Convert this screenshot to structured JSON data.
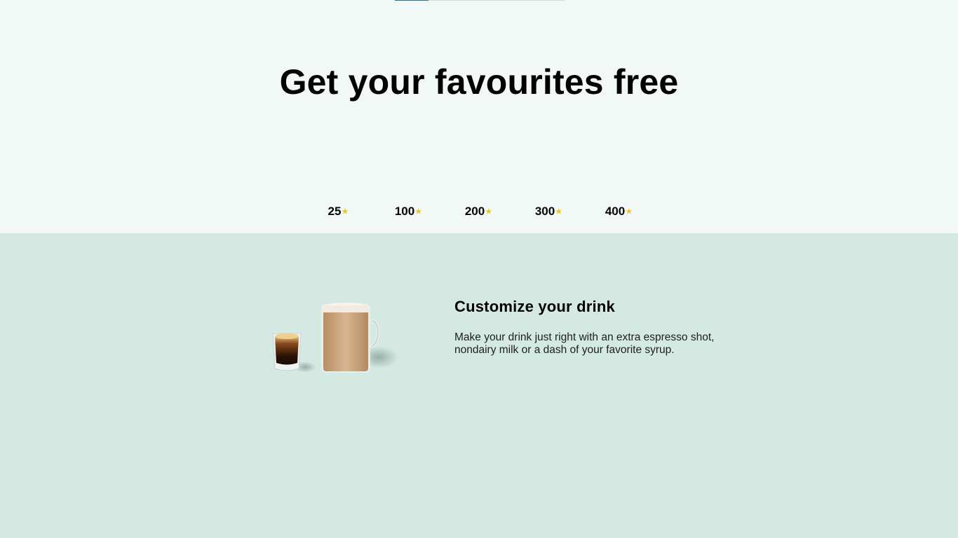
{
  "rewards": {
    "headline": "Get your favourites free",
    "tiers": [
      {
        "value": "25",
        "icon": "star-icon"
      },
      {
        "value": "100",
        "icon": "star-icon"
      },
      {
        "value": "200",
        "icon": "star-icon"
      },
      {
        "value": "300",
        "icon": "star-icon"
      },
      {
        "value": "400",
        "icon": "star-icon"
      }
    ],
    "star_glyph": "★"
  },
  "feature": {
    "title": "Customize your drink",
    "description": "Make your drink just right with an extra espresso shot, nondairy milk or a dash of your favorite syrup.",
    "image": "espresso-and-latte-mug"
  },
  "colors": {
    "top_background": "#f1f8f6",
    "bottom_background": "#d4e9e2",
    "star": "#f0c419",
    "scroll_thumb": "#1f6fb5"
  }
}
